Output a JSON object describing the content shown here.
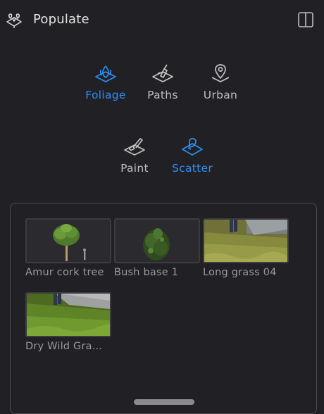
{
  "header": {
    "title": "Populate",
    "icon": "populate-icon",
    "toggle_icon": "split-panel-icon"
  },
  "modes": [
    {
      "label": "Foliage",
      "icon": "foliage-icon",
      "active": true
    },
    {
      "label": "Paths",
      "icon": "paths-icon",
      "active": false
    },
    {
      "label": "Urban",
      "icon": "map-pin-icon",
      "active": false
    },
    {
      "label": "Paint",
      "icon": "paint-icon",
      "active": false
    },
    {
      "label": "Scatter",
      "icon": "scatter-icon",
      "active": true
    }
  ],
  "assets": [
    {
      "label": "Amur cork tree",
      "thumbnail": "tree-thumbnail"
    },
    {
      "label": "Bush base 1",
      "thumbnail": "bush-thumbnail"
    },
    {
      "label": "Long grass 04",
      "thumbnail": "grass-photo-thumbnail"
    },
    {
      "label": "Dry Wild Gra...",
      "thumbnail": "grass-photo-thumbnail"
    }
  ],
  "colors": {
    "accent": "#2d8ef2",
    "background": "#212125",
    "text": "#d6d6d6"
  }
}
